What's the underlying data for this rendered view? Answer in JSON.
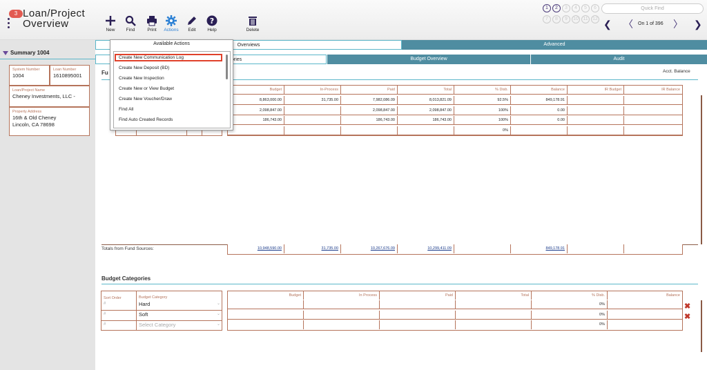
{
  "header": {
    "badge": "3",
    "title_line1": "Loan/Project",
    "title_line2": "Overview",
    "toolbar": [
      {
        "label": "New",
        "icon": "plus-icon"
      },
      {
        "label": "Find",
        "icon": "search-icon"
      },
      {
        "label": "Print",
        "icon": "printer-icon"
      },
      {
        "label": "Actions",
        "icon": "gear-icon",
        "active": true
      },
      {
        "label": "Edit",
        "icon": "pencil-icon"
      },
      {
        "label": "Help",
        "icon": "help-icon"
      },
      {
        "label": "Delete",
        "icon": "trash-icon"
      }
    ],
    "page_circles": [
      "1",
      "2",
      "3",
      "4",
      "5",
      "6",
      "7",
      "8",
      "9",
      "10",
      "11",
      "12"
    ],
    "quick_find_placeholder": "Quick Find",
    "page_info": "On 1 of 396"
  },
  "sidebar": {
    "title": "Summary 1004",
    "system_number_label": "System Number",
    "system_number": "1004",
    "loan_number_label": "Loan Number",
    "loan_number": "1610895001",
    "loan_project_name_label": "Loan/Project Name",
    "loan_project_name": "Cheney Investments, LLC -",
    "property_address_label": "Property Address",
    "address_line1": "16th & Old Cheney",
    "address_line2": "Lincoln, CA   78698"
  },
  "tabs": {
    "overviews": "Overviews",
    "advanced": "Advanced"
  },
  "subtabs": {
    "categories": "ories",
    "budget_overview": "Budget Overview",
    "audit": "Audit"
  },
  "fund_section": {
    "title_partial": "Fu",
    "acct_balance": "Acct. Balance",
    "headers": [
      "Budget",
      "In-Process",
      "Paid",
      "Total",
      "% Disb.",
      "Balance",
      "IR Budget",
      "IR Balance"
    ],
    "rows": [
      [
        "8,863,000.00",
        "31,735.00",
        "7,982,086.09",
        "8,013,821.09",
        "92.5%",
        "849,178.91",
        "",
        ""
      ],
      [
        "2,098,847.00",
        "",
        "2,098,847.00",
        "2,098,847.00",
        "100%",
        "0.00",
        "",
        ""
      ],
      [
        "186,743.00",
        "",
        "186,743.00",
        "186,743.00",
        "100%",
        "0.00",
        "",
        ""
      ],
      [
        "",
        "",
        "",
        "",
        "0%",
        "",
        "",
        ""
      ]
    ],
    "totals_label": "Totals from Fund Sources:",
    "totals": [
      "10,948,590.00",
      "31,735.00",
      "10,267,676.09",
      "10,299,411.09",
      "",
      "849,178.91",
      "",
      ""
    ]
  },
  "budget_categories": {
    "title": "Budget Categories",
    "sort_order_label": "Sort Order",
    "budget_category_label": "Budget Category",
    "rows": [
      {
        "sort": "#",
        "category": "Hard",
        "pct": "0%"
      },
      {
        "sort": "#",
        "category": "Soft",
        "pct": "0%"
      },
      {
        "sort": "#",
        "category": "Select Category",
        "pct": "0%"
      }
    ],
    "headers": [
      "Budget",
      "In Process",
      "Paid",
      "Total",
      "% Disb.",
      "Balance"
    ]
  },
  "actions_menu": {
    "title": "Available Actions",
    "items": [
      "Create New Communication Log",
      "Create New Deposit (BD)",
      "Create New Inspection",
      "Create New or View Budget",
      "Create New Voucher/Draw",
      "Find All",
      "Find Auto Created Records"
    ]
  },
  "colors": {
    "accent": "#5ab6c9",
    "tab_dark": "#4f8da1",
    "border": "#b5735a",
    "highlight": "#e0402a"
  }
}
